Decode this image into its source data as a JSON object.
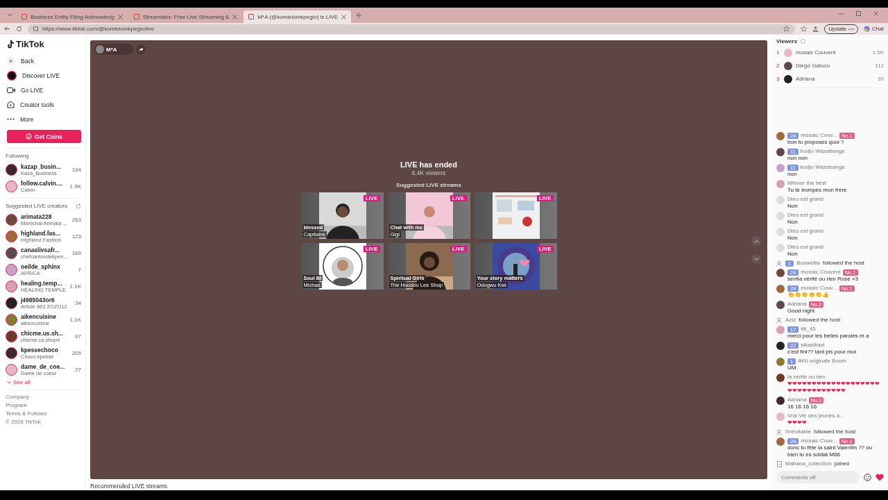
{
  "browser": {
    "tabs": [
      {
        "title": "Business Entity Filing Acknowledg",
        "selected": false
      },
      {
        "title": "Streamlabs: Free Live Streaming &",
        "selected": false
      },
      {
        "title": "M*A (@komielomkpeglo) is LIVE",
        "selected": true
      }
    ],
    "url": "https://www.tiktok.com/@komielomkpeglo/live",
    "update": "Update",
    "chat": "Chat"
  },
  "sidebar": {
    "logo": "TikTok",
    "nav": [
      {
        "kind": "back",
        "label": "Back"
      },
      {
        "kind": "discover",
        "label": "Discover LIVE"
      },
      {
        "kind": "golive",
        "label": "Go LIVE"
      },
      {
        "kind": "tools",
        "label": "Creator tools"
      },
      {
        "kind": "more",
        "label": "More"
      }
    ],
    "coins_button": "Get Coins",
    "following_title": "Following",
    "following": [
      {
        "name": "kazap_busin...",
        "sub": "Kaza_Business",
        "count": "134"
      },
      {
        "name": "follow.calvin....",
        "sub": "Calvin",
        "count": "1.9K"
      }
    ],
    "suggested_title": "Suggested LIVE creators",
    "suggested": [
      {
        "name": "arimata228",
        "sub": "Maréchal Arimata ...",
        "count": "263"
      },
      {
        "name": "highland.fas...",
        "sub": "Highland Fashion",
        "count": "123"
      },
      {
        "name": "canaslivsafr...",
        "sub": "chefcantondekpen...",
        "count": "169"
      },
      {
        "name": "oeilde_sphinx",
        "sub": "AFRICA",
        "count": "7"
      },
      {
        "name": "healing.temp...",
        "sub": "HEALING TEMPLE",
        "count": "1.1K"
      },
      {
        "name": "j4985043or6",
        "sub": "Article 663 ZOZO12",
        "count": "34"
      },
      {
        "name": "aikencuisine",
        "sub": "aikencuisine",
        "count": "1.1K"
      },
      {
        "name": "chicme.us.sh...",
        "sub": "chicme.us.shop4",
        "count": "97"
      },
      {
        "name": "kpessechoco",
        "sub": "Choco kpesse",
        "count": "205"
      },
      {
        "name": "dame_de_coe...",
        "sub": "Dame de coeur",
        "count": "27"
      }
    ],
    "see_all": "See all",
    "footer": [
      "Company",
      "Program",
      "Terms & Policies",
      "© 2026 TikTok"
    ]
  },
  "video": {
    "host": "M*A",
    "title": "LIVE has ended",
    "viewers": "6.4K viewers",
    "suggested_title": "Suggested LIVE streams",
    "cards": [
      {
        "badge": "LIVE",
        "title": "blessed",
        "sub": "Capitaine"
      },
      {
        "badge": "LIVE",
        "title": "Chat with me",
        "sub": "Gigi"
      },
      {
        "badge": "LIVE"
      },
      {
        "badge": "LIVE",
        "title": "Soul Bl",
        "sub": "Michae"
      },
      {
        "badge": "LIVE",
        "title": "Spiritual Girls",
        "sub": "The Hoodoo Lee Shop"
      },
      {
        "badge": "LIVE",
        "title": "Your story matters",
        "sub": "Odogwu Kwi"
      }
    ]
  },
  "recommended_title": "Recommended LIVE streams",
  "viewers": {
    "title": "Viewers",
    "list": [
      {
        "rank": "1",
        "name": "mosaic Couvent",
        "count": "1.5K"
      },
      {
        "rank": "2",
        "name": "Diego Gatuzo",
        "count": "112"
      },
      {
        "rank": "3",
        "name": "Adriana",
        "count": "30"
      }
    ]
  },
  "chat": [
    {
      "kind": "comment",
      "level": "24",
      "name": "mosaic Couv...",
      "rank": "No.1",
      "text": "bon tu proposes quoi ?"
    },
    {
      "kind": "comment",
      "level": "11",
      "name": "kodjo Wazabanga",
      "text": "non non"
    },
    {
      "kind": "comment",
      "level": "11",
      "name": "kodjo Wazabanga",
      "text": "non"
    },
    {
      "kind": "comment",
      "name": "Winner the best",
      "text": "Tu te trompes mon frère"
    },
    {
      "kind": "comment",
      "name": "Dieu est grand",
      "text": "Non"
    },
    {
      "kind": "comment",
      "name": "Dieu est grand",
      "text": "Non"
    },
    {
      "kind": "comment",
      "name": "Dieu est grand",
      "text": "Non"
    },
    {
      "kind": "comment",
      "name": "Dieu est grand",
      "text": "Non"
    },
    {
      "kind": "event",
      "level": "1",
      "name": "Boswellia",
      "text": "followed the host"
    },
    {
      "kind": "comment",
      "level": "24",
      "name": "mosaic Couvent",
      "rank": "No.1",
      "text": "sentia vérité ou rien  Rose ×3"
    },
    {
      "kind": "comment",
      "level": "24",
      "name": "mosaic Couv...",
      "rank": "No.1",
      "text": "👏👏👏👏👏👍"
    },
    {
      "kind": "comment",
      "name": "Adriana",
      "rank": "No.2",
      "text": "Good night"
    },
    {
      "kind": "event",
      "name": "Aziz",
      "text": "followed the host"
    },
    {
      "kind": "comment",
      "level": "17",
      "name": "titi_45",
      "text": "merci pour les belles paroles m a"
    },
    {
      "kind": "comment",
      "level": "22",
      "name": "sikasikavi",
      "text": "c'est fini?? tant pis pour moi"
    },
    {
      "kind": "comment",
      "level": "1",
      "name": "AKil originale Boom",
      "text": "UM"
    },
    {
      "kind": "comment",
      "name": "la vérité ou rien",
      "text": "❤❤❤❤❤❤❤❤❤❤❤❤❤❤❤❤❤❤❤❤❤❤❤❤❤❤❤❤❤❤❤"
    },
    {
      "kind": "comment",
      "name": "Adriana",
      "rank": "No.2",
      "text": "16 16 16 16"
    },
    {
      "kind": "comment",
      "name": "Vrai Vie des jeunes a...",
      "text": "❤❤❤❤"
    },
    {
      "kind": "event",
      "name": "l'inévitable",
      "text": "followed the host"
    },
    {
      "kind": "comment",
      "level": "24",
      "name": "mosaic Couv...",
      "rank": "No.1",
      "text": "donc tu fête la saint Valentin ?? ou bien tu es soldat M66"
    },
    {
      "kind": "join",
      "name": "Mahana_collection",
      "text": "joined"
    }
  ],
  "comment_box": {
    "placeholder": "Comments off"
  }
}
